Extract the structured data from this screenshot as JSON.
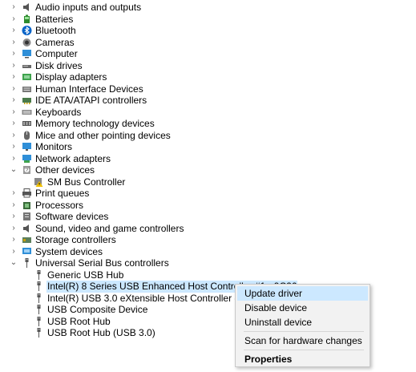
{
  "device_tree": [
    {
      "label": "Audio inputs and outputs",
      "expanded": false,
      "icon": "speaker-icon"
    },
    {
      "label": "Batteries",
      "expanded": false,
      "icon": "battery-icon"
    },
    {
      "label": "Bluetooth",
      "expanded": false,
      "icon": "bluetooth-icon"
    },
    {
      "label": "Cameras",
      "expanded": false,
      "icon": "camera-icon"
    },
    {
      "label": "Computer",
      "expanded": false,
      "icon": "computer-icon"
    },
    {
      "label": "Disk drives",
      "expanded": false,
      "icon": "disk-drive-icon"
    },
    {
      "label": "Display adapters",
      "expanded": false,
      "icon": "display-adapter-icon"
    },
    {
      "label": "Human Interface Devices",
      "expanded": false,
      "icon": "hid-icon"
    },
    {
      "label": "IDE ATA/ATAPI controllers",
      "expanded": false,
      "icon": "ide-controller-icon"
    },
    {
      "label": "Keyboards",
      "expanded": false,
      "icon": "keyboard-icon"
    },
    {
      "label": "Memory technology devices",
      "expanded": false,
      "icon": "memory-icon"
    },
    {
      "label": "Mice and other pointing devices",
      "expanded": false,
      "icon": "mouse-icon"
    },
    {
      "label": "Monitors",
      "expanded": false,
      "icon": "monitor-icon"
    },
    {
      "label": "Network adapters",
      "expanded": false,
      "icon": "network-adapter-icon"
    },
    {
      "label": "Other devices",
      "expanded": true,
      "icon": "unknown-device-icon",
      "children": [
        {
          "label": "SM Bus Controller",
          "icon": "warning-device-icon"
        }
      ]
    },
    {
      "label": "Print queues",
      "expanded": false,
      "icon": "printer-icon"
    },
    {
      "label": "Processors",
      "expanded": false,
      "icon": "processor-icon"
    },
    {
      "label": "Software devices",
      "expanded": false,
      "icon": "software-device-icon"
    },
    {
      "label": "Sound, video and game controllers",
      "expanded": false,
      "icon": "sound-icon"
    },
    {
      "label": "Storage controllers",
      "expanded": false,
      "icon": "storage-controller-icon"
    },
    {
      "label": "System devices",
      "expanded": false,
      "icon": "system-device-icon"
    },
    {
      "label": "Universal Serial Bus controllers",
      "expanded": true,
      "icon": "usb-icon",
      "children": [
        {
          "label": "Generic USB Hub",
          "icon": "usb-icon"
        },
        {
          "label": "Intel(R) 8 Series USB Enhanced Host Controller #1 - 9C26",
          "icon": "usb-icon",
          "selected": true
        },
        {
          "label": "Intel(R) USB 3.0 eXtensible Host Controller - 1.0 (Microsoft)",
          "icon": "usb-icon"
        },
        {
          "label": "USB Composite Device",
          "icon": "usb-icon"
        },
        {
          "label": "USB Root Hub",
          "icon": "usb-icon"
        },
        {
          "label": "USB Root Hub (USB 3.0)",
          "icon": "usb-icon"
        }
      ]
    }
  ],
  "context_menu": {
    "items": [
      {
        "label": "Update driver",
        "highlighted": true
      },
      {
        "label": "Disable device"
      },
      {
        "label": "Uninstall device"
      },
      {
        "label": "Scan for hardware changes",
        "separator_before": true
      },
      {
        "label": "Properties",
        "bold": true,
        "separator_before": true
      }
    ]
  },
  "colors": {
    "selection": "#cce8ff",
    "menu_background": "#f2f2f2",
    "menu_border": "#c9c9c9",
    "expander": "#555555"
  }
}
